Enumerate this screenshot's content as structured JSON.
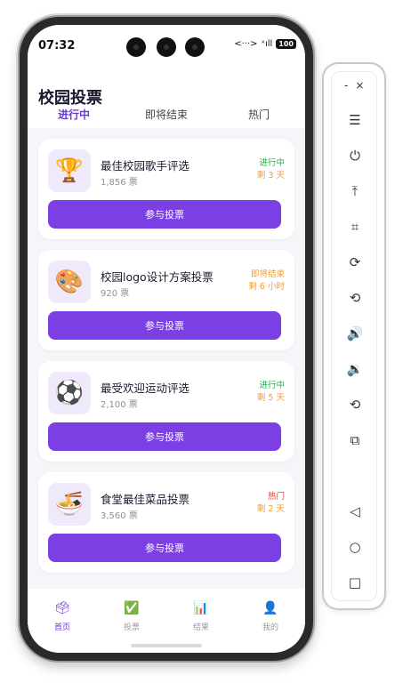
{
  "status_bar": {
    "time": "07:32",
    "network_icon": "<···>",
    "signal_text": "ˣıll",
    "battery": "100"
  },
  "header": {
    "title": "校园投票",
    "tabs": [
      {
        "label": "进行中",
        "active": true
      },
      {
        "label": "即将结束",
        "active": false
      },
      {
        "label": "热门",
        "active": false
      }
    ]
  },
  "cards": [
    {
      "icon": "🏆",
      "title": "最佳校园歌手评选",
      "votes": "1,856 票",
      "status": "进行中",
      "remaining": "剩 3 天",
      "button": "参与投票"
    },
    {
      "icon": "🎨",
      "title": "校园logo设计方案投票",
      "votes": "920 票",
      "status": "即将结束",
      "remaining": "剩 6 小时",
      "button": "参与投票"
    },
    {
      "icon": "⚽",
      "title": "最受欢迎运动评选",
      "votes": "2,100 票",
      "status": "进行中",
      "remaining": "剩 5 天",
      "button": "参与投票"
    },
    {
      "icon": "🍜",
      "title": "食堂最佳菜品投票",
      "votes": "3,560 票",
      "status": "热门",
      "remaining": "剩 2 天",
      "button": "参与投票"
    }
  ],
  "bottom_nav": [
    {
      "label": "首页",
      "icon": "🗳",
      "active": true
    },
    {
      "label": "投票",
      "icon": "✅",
      "active": false
    },
    {
      "label": "结果",
      "icon": "📊",
      "active": false
    },
    {
      "label": "我的",
      "icon": "👤",
      "active": false
    }
  ],
  "toolbar": {
    "minimize": "-",
    "close": "×",
    "buttons": [
      "☰",
      "⏻",
      "⤒",
      "⌗",
      "⟳",
      "⟲",
      "🔊",
      "🔉",
      "⟲",
      "⧉"
    ],
    "nav": [
      "◁",
      "○",
      "□"
    ]
  },
  "colors": {
    "accent": "#7b3fe4",
    "green": "#22b14c",
    "orange": "#f29b2a",
    "red": "#e2443a"
  }
}
